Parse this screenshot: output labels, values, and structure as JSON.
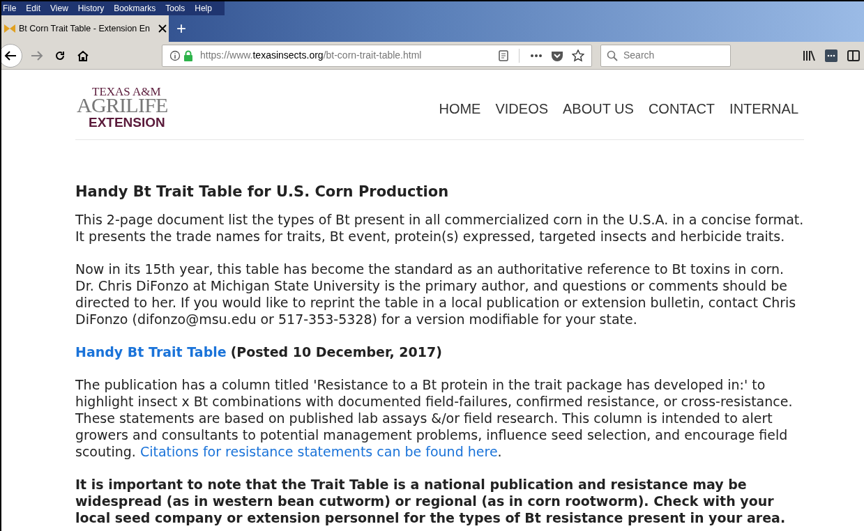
{
  "menu_bar": [
    "File",
    "Edit",
    "View",
    "History",
    "Bookmarks",
    "Tools",
    "Help"
  ],
  "tabs": [
    {
      "label": "Bt Corn Trait Table - Extension En",
      "selected": true
    },
    {
      "label": "+",
      "kind": "new"
    }
  ],
  "address_bar": {
    "prefix": "https://www.",
    "domain": "texasinsects.org",
    "path": "/bt-corn-trait-table.html"
  },
  "search": {
    "placeholder": "Search"
  },
  "site": {
    "logo": {
      "line_1": "TEXAS A&M",
      "line_2": "AGRILIFE",
      "line_3": "EXTENSION"
    },
    "nav": [
      "HOME",
      "VIDEOS",
      "ABOUT US",
      "CONTACT",
      "INTERNAL"
    ]
  },
  "article": {
    "title": "Handy Bt Trait Table for U.S. Corn Production",
    "paragraphs": [
      {
        "kind": "text",
        "text": "This 2-page document list the types of Bt present in all commercialized corn in the U.S.A. in a concise format. It presents the trade names for traits, Bt event, protein(s) expressed, targeted insects and herbicide traits."
      },
      {
        "kind": "text",
        "text": "Now in its 15th year, this table has become the standard as an authoritative reference to Bt toxins in corn. Dr. Chris DiFonzo at Michigan State University is the primary author, and questions or comments should be directed to her. If you would like to reprint the table in a local publication or  extension bulletin, contact Chris DiFonzo (difonzo@msu.edu or 517-353-5328) for a version modifiable for your state."
      },
      {
        "kind": "link_line",
        "link": "Handy Bt Trait Table",
        "text": "(Posted 10 December, 2017)"
      },
      {
        "kind": "text_link",
        "text": "The publication has a column titled 'Resistance to a Bt protein in the trait package has developed in:' to highlight insect x Bt combinations with documented field-failures, confirmed resistance, or cross-resistance. These statements are based on published lab assays &/or field research. This column is intended to alert growers and consultants to potential management problems, influence seed selection, and encourage field scouting.",
        "link": "Citations for resistance statements can be found here",
        "after": "."
      },
      {
        "kind": "bold",
        "text": "It is important to note that the Trait Table is a national publication and resistance may be widespread (as in western bean cutworm) or regional (as in corn rootworm). Check with your local seed company or extension personnel for the types of Bt resistance present in your area."
      }
    ]
  }
}
